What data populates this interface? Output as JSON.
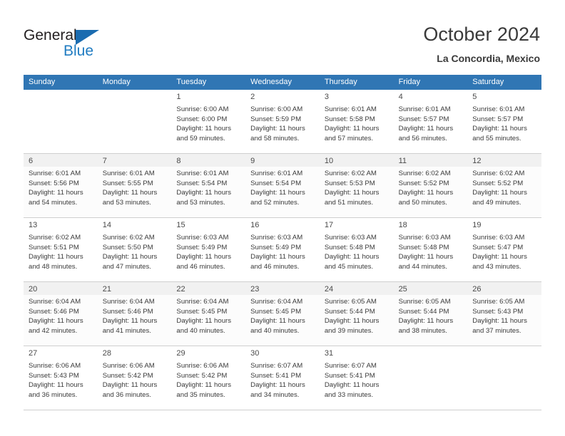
{
  "brand": {
    "name_part1": "General",
    "name_part2": "Blue",
    "triangle_icon": "triangle-icon",
    "color_dark": "#231f20",
    "color_blue": "#1f7bc1"
  },
  "header": {
    "title": "October 2024",
    "subtitle": "La Concordia, Mexico"
  },
  "theme": {
    "header_bg": "#3076b4",
    "header_text": "#ffffff",
    "row_shade": "#f1f1f1",
    "grid_line": "#cfcfcf"
  },
  "weekdays": [
    "Sunday",
    "Monday",
    "Tuesday",
    "Wednesday",
    "Thursday",
    "Friday",
    "Saturday"
  ],
  "labels": {
    "sunrise_prefix": "Sunrise:",
    "sunset_prefix": "Sunset:",
    "daylight_prefix": "Daylight:"
  },
  "weeks": [
    [
      {
        "day": "",
        "l1": "",
        "l2": "",
        "l3": "",
        "l4": ""
      },
      {
        "day": "",
        "l1": "",
        "l2": "",
        "l3": "",
        "l4": ""
      },
      {
        "day": "1",
        "l1": "Sunrise: 6:00 AM",
        "l2": "Sunset: 6:00 PM",
        "l3": "Daylight: 11 hours",
        "l4": "and 59 minutes."
      },
      {
        "day": "2",
        "l1": "Sunrise: 6:00 AM",
        "l2": "Sunset: 5:59 PM",
        "l3": "Daylight: 11 hours",
        "l4": "and 58 minutes."
      },
      {
        "day": "3",
        "l1": "Sunrise: 6:01 AM",
        "l2": "Sunset: 5:58 PM",
        "l3": "Daylight: 11 hours",
        "l4": "and 57 minutes."
      },
      {
        "day": "4",
        "l1": "Sunrise: 6:01 AM",
        "l2": "Sunset: 5:57 PM",
        "l3": "Daylight: 11 hours",
        "l4": "and 56 minutes."
      },
      {
        "day": "5",
        "l1": "Sunrise: 6:01 AM",
        "l2": "Sunset: 5:57 PM",
        "l3": "Daylight: 11 hours",
        "l4": "and 55 minutes."
      }
    ],
    [
      {
        "day": "6",
        "l1": "Sunrise: 6:01 AM",
        "l2": "Sunset: 5:56 PM",
        "l3": "Daylight: 11 hours",
        "l4": "and 54 minutes."
      },
      {
        "day": "7",
        "l1": "Sunrise: 6:01 AM",
        "l2": "Sunset: 5:55 PM",
        "l3": "Daylight: 11 hours",
        "l4": "and 53 minutes."
      },
      {
        "day": "8",
        "l1": "Sunrise: 6:01 AM",
        "l2": "Sunset: 5:54 PM",
        "l3": "Daylight: 11 hours",
        "l4": "and 53 minutes."
      },
      {
        "day": "9",
        "l1": "Sunrise: 6:01 AM",
        "l2": "Sunset: 5:54 PM",
        "l3": "Daylight: 11 hours",
        "l4": "and 52 minutes."
      },
      {
        "day": "10",
        "l1": "Sunrise: 6:02 AM",
        "l2": "Sunset: 5:53 PM",
        "l3": "Daylight: 11 hours",
        "l4": "and 51 minutes."
      },
      {
        "day": "11",
        "l1": "Sunrise: 6:02 AM",
        "l2": "Sunset: 5:52 PM",
        "l3": "Daylight: 11 hours",
        "l4": "and 50 minutes."
      },
      {
        "day": "12",
        "l1": "Sunrise: 6:02 AM",
        "l2": "Sunset: 5:52 PM",
        "l3": "Daylight: 11 hours",
        "l4": "and 49 minutes."
      }
    ],
    [
      {
        "day": "13",
        "l1": "Sunrise: 6:02 AM",
        "l2": "Sunset: 5:51 PM",
        "l3": "Daylight: 11 hours",
        "l4": "and 48 minutes."
      },
      {
        "day": "14",
        "l1": "Sunrise: 6:02 AM",
        "l2": "Sunset: 5:50 PM",
        "l3": "Daylight: 11 hours",
        "l4": "and 47 minutes."
      },
      {
        "day": "15",
        "l1": "Sunrise: 6:03 AM",
        "l2": "Sunset: 5:49 PM",
        "l3": "Daylight: 11 hours",
        "l4": "and 46 minutes."
      },
      {
        "day": "16",
        "l1": "Sunrise: 6:03 AM",
        "l2": "Sunset: 5:49 PM",
        "l3": "Daylight: 11 hours",
        "l4": "and 46 minutes."
      },
      {
        "day": "17",
        "l1": "Sunrise: 6:03 AM",
        "l2": "Sunset: 5:48 PM",
        "l3": "Daylight: 11 hours",
        "l4": "and 45 minutes."
      },
      {
        "day": "18",
        "l1": "Sunrise: 6:03 AM",
        "l2": "Sunset: 5:48 PM",
        "l3": "Daylight: 11 hours",
        "l4": "and 44 minutes."
      },
      {
        "day": "19",
        "l1": "Sunrise: 6:03 AM",
        "l2": "Sunset: 5:47 PM",
        "l3": "Daylight: 11 hours",
        "l4": "and 43 minutes."
      }
    ],
    [
      {
        "day": "20",
        "l1": "Sunrise: 6:04 AM",
        "l2": "Sunset: 5:46 PM",
        "l3": "Daylight: 11 hours",
        "l4": "and 42 minutes."
      },
      {
        "day": "21",
        "l1": "Sunrise: 6:04 AM",
        "l2": "Sunset: 5:46 PM",
        "l3": "Daylight: 11 hours",
        "l4": "and 41 minutes."
      },
      {
        "day": "22",
        "l1": "Sunrise: 6:04 AM",
        "l2": "Sunset: 5:45 PM",
        "l3": "Daylight: 11 hours",
        "l4": "and 40 minutes."
      },
      {
        "day": "23",
        "l1": "Sunrise: 6:04 AM",
        "l2": "Sunset: 5:45 PM",
        "l3": "Daylight: 11 hours",
        "l4": "and 40 minutes."
      },
      {
        "day": "24",
        "l1": "Sunrise: 6:05 AM",
        "l2": "Sunset: 5:44 PM",
        "l3": "Daylight: 11 hours",
        "l4": "and 39 minutes."
      },
      {
        "day": "25",
        "l1": "Sunrise: 6:05 AM",
        "l2": "Sunset: 5:44 PM",
        "l3": "Daylight: 11 hours",
        "l4": "and 38 minutes."
      },
      {
        "day": "26",
        "l1": "Sunrise: 6:05 AM",
        "l2": "Sunset: 5:43 PM",
        "l3": "Daylight: 11 hours",
        "l4": "and 37 minutes."
      }
    ],
    [
      {
        "day": "27",
        "l1": "Sunrise: 6:06 AM",
        "l2": "Sunset: 5:43 PM",
        "l3": "Daylight: 11 hours",
        "l4": "and 36 minutes."
      },
      {
        "day": "28",
        "l1": "Sunrise: 6:06 AM",
        "l2": "Sunset: 5:42 PM",
        "l3": "Daylight: 11 hours",
        "l4": "and 36 minutes."
      },
      {
        "day": "29",
        "l1": "Sunrise: 6:06 AM",
        "l2": "Sunset: 5:42 PM",
        "l3": "Daylight: 11 hours",
        "l4": "and 35 minutes."
      },
      {
        "day": "30",
        "l1": "Sunrise: 6:07 AM",
        "l2": "Sunset: 5:41 PM",
        "l3": "Daylight: 11 hours",
        "l4": "and 34 minutes."
      },
      {
        "day": "31",
        "l1": "Sunrise: 6:07 AM",
        "l2": "Sunset: 5:41 PM",
        "l3": "Daylight: 11 hours",
        "l4": "and 33 minutes."
      },
      {
        "day": "",
        "l1": "",
        "l2": "",
        "l3": "",
        "l4": ""
      },
      {
        "day": "",
        "l1": "",
        "l2": "",
        "l3": "",
        "l4": ""
      }
    ]
  ]
}
